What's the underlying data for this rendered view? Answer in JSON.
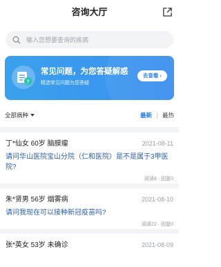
{
  "header": {
    "title": "咨询大厅"
  },
  "search": {
    "placeholder": "输入您想要查询的疾病"
  },
  "banner": {
    "title": "常见问题，为您答疑解惑",
    "subtitle": "精选常见问题为您答疑",
    "button": "去查看 ›"
  },
  "filter": {
    "department": "全部病种",
    "sort_new": "最新",
    "sort_hot": "最热"
  },
  "questions": [
    {
      "asker": "丁*仙女 60岁 脑膜瘤",
      "date": "2021-08-11",
      "text": "请问华山医院宝山分院（仁和医院）是不是属于3甲医院?",
      "stats": "阅读8 · 回复0"
    },
    {
      "asker": "朱*贤男 56岁 烟雾病",
      "date": "2021-08-10",
      "text": "请问我现在可以接种新冠疫苗吗?",
      "stats": "阅读22 · 回复0"
    },
    {
      "asker": "张*英女 53岁 未确诊",
      "date": "2021-08-09",
      "text": "",
      "stats": ""
    }
  ],
  "colors": {
    "accent": "#2f7fe0",
    "question_text": "#2c5fa8",
    "banner_start": "#3aa1ec",
    "banner_end": "#3b8ff0"
  }
}
